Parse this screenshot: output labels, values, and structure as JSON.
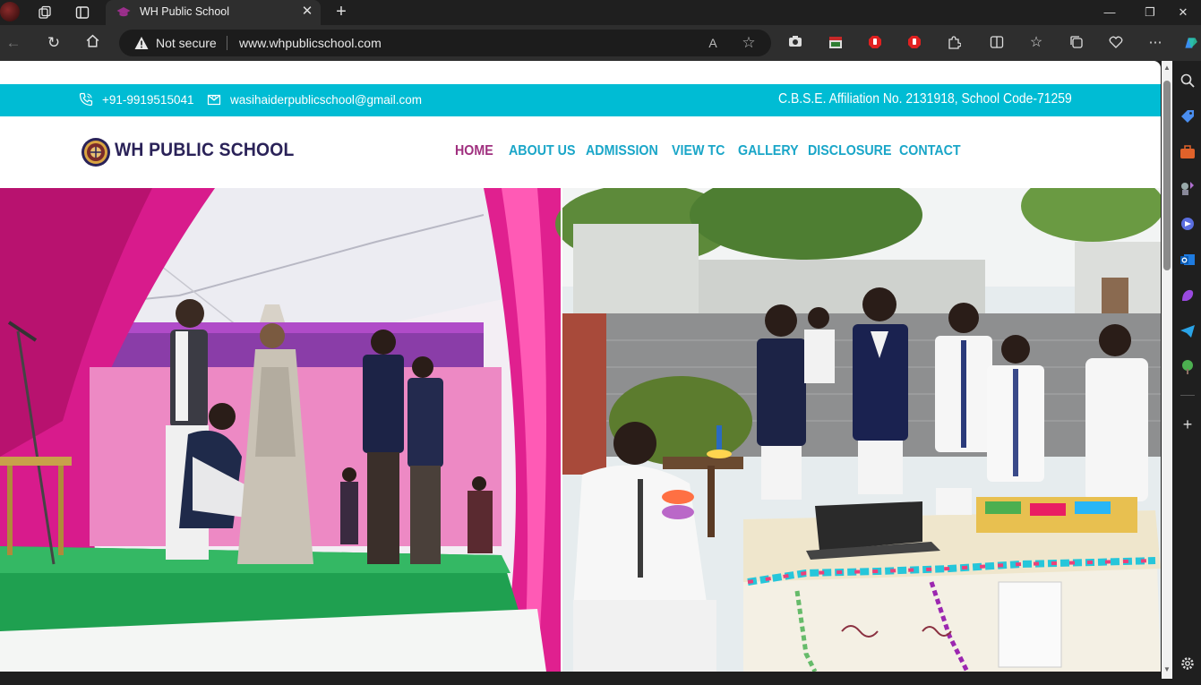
{
  "browser": {
    "tab": {
      "title": "WH Public School"
    },
    "address": {
      "security_label": "Not secure",
      "url": "www.whpublicschool.com"
    }
  },
  "site": {
    "topbar": {
      "phone": "+91-9919515041",
      "email": "wasihaiderpublicschool@gmail.com",
      "affiliation": "C.B.S.E. Affiliation No. 2131918, School Code-71259"
    },
    "logo_text": "WH PUBLIC SCHOOL",
    "nav": [
      {
        "label": "HOME",
        "active": true
      },
      {
        "label": "ABOUT US",
        "active": false
      },
      {
        "label": "ADMISSION",
        "active": false
      },
      {
        "label": "VIEW TC",
        "active": false
      },
      {
        "label": "GALLERY",
        "active": false
      },
      {
        "label": "DISCLOSURE",
        "active": false
      },
      {
        "label": "CONTACT",
        "active": false
      }
    ],
    "hero_alt": "School event collage"
  },
  "colors": {
    "topbar_bg": "#00bcd4",
    "nav_link": "#1aa6c8",
    "nav_active": "#a0307f",
    "logo_text": "#2a2258"
  }
}
